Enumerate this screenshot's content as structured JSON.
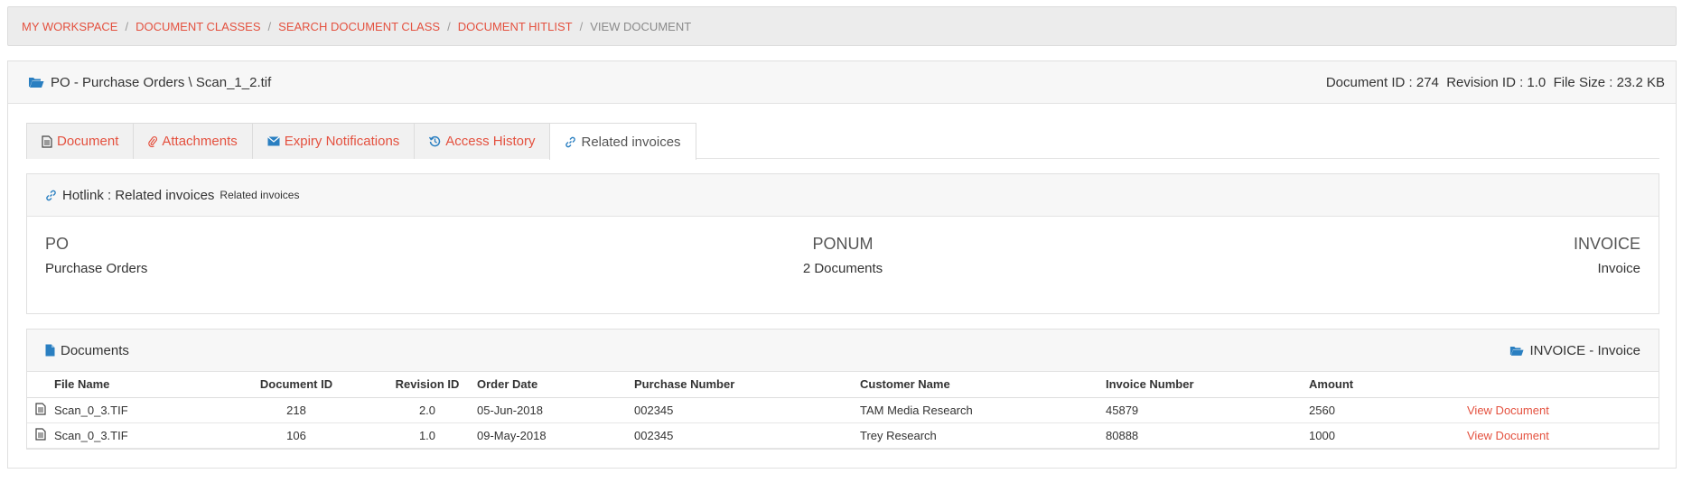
{
  "breadcrumb": {
    "items": [
      "MY WORKSPACE",
      "DOCUMENT CLASSES",
      "SEARCH DOCUMENT CLASS",
      "DOCUMENT HITLIST"
    ],
    "current": "VIEW DOCUMENT",
    "separator": "/"
  },
  "header": {
    "title": "PO - Purchase Orders \\ Scan_1_2.tif",
    "meta": "Document ID : 274  Revision ID : 1.0  File Size : 23.2 KB"
  },
  "tabs": [
    {
      "label": "Document",
      "icon": "file-text-icon"
    },
    {
      "label": "Attachments",
      "icon": "paperclip-icon"
    },
    {
      "label": "Expiry Notifications",
      "icon": "envelope-icon"
    },
    {
      "label": "Access History",
      "icon": "history-icon"
    },
    {
      "label": "Related invoices",
      "icon": "link-icon",
      "active": true
    }
  ],
  "hotlink": {
    "title": "Hotlink : Related invoices",
    "subtitle": "Related invoices",
    "left": {
      "heading": "PO",
      "value": "Purchase Orders"
    },
    "mid": {
      "heading": "PONUM",
      "value": "2 Documents"
    },
    "right": {
      "heading": "INVOICE",
      "value": "Invoice"
    }
  },
  "documents": {
    "title": "Documents",
    "class_label": "INVOICE - Invoice",
    "columns": [
      "File Name",
      "Document ID",
      "Revision ID",
      "Order Date",
      "Purchase Number",
      "Customer Name",
      "Invoice Number",
      "Amount"
    ],
    "rows": [
      {
        "file": "Scan_0_3.TIF",
        "doc_id": "218",
        "rev": "2.0",
        "date": "05-Jun-2018",
        "pn": "002345",
        "customer": "TAM Media Research",
        "invoice": "45879",
        "amount": "2560",
        "action": "View Document"
      },
      {
        "file": "Scan_0_3.TIF",
        "doc_id": "106",
        "rev": "1.0",
        "date": "09-May-2018",
        "pn": "002345",
        "customer": "Trey Research",
        "invoice": "80888",
        "amount": "1000",
        "action": "View Document"
      }
    ]
  },
  "colors": {
    "accent": "#e4513f",
    "icon_blue": "#2a7fc1"
  }
}
